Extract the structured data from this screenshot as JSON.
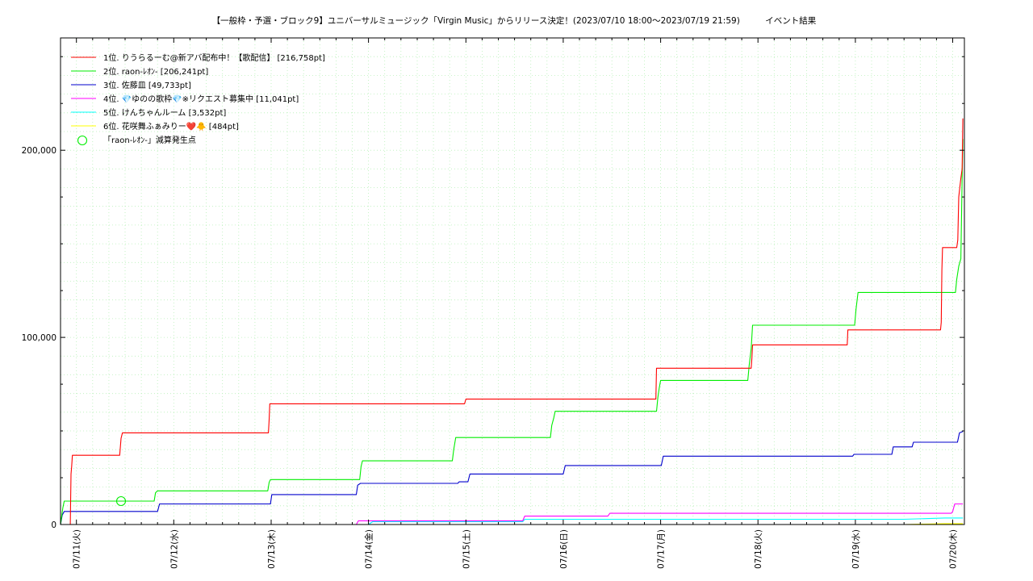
{
  "chart_data": {
    "type": "line",
    "title": "【一般枠・予選・ブロック9】ユニバーサルミュージック「Virgin Music」からリリース決定！(2023/07/10 18:00～2023/07/19 21:59)　　　イベント結果",
    "xlabel": "",
    "ylabel": "",
    "x_ticks": [
      "07/11(火)",
      "07/12(水)",
      "07/13(木)",
      "07/14(金)",
      "07/15(土)",
      "07/16(日)",
      "07/17(月)",
      "07/18(火)",
      "07/19(水)",
      "07/20(木)"
    ],
    "y_ticks": [
      0,
      100000,
      200000
    ],
    "y_tick_labels": [
      "0",
      "100,000",
      "200,000"
    ],
    "xlim": [
      "07/10 20:05",
      "07/20 02:53"
    ],
    "ylim": [
      0,
      260000
    ],
    "grid": true,
    "legend_position": "top-left",
    "series": [
      {
        "name": "1位. りうらるーむ@新アバ配布中！【歌配信】 [216,758pt]",
        "color": "#ff0000",
        "points": [
          [
            "07/10 22:30",
            0
          ],
          [
            "07/10 22:40",
            27000
          ],
          [
            "07/10 22:50",
            31000
          ],
          [
            "07/10 23:00",
            37000
          ],
          [
            "07/11 10:40",
            37000
          ],
          [
            "07/11 11:00",
            46000
          ],
          [
            "07/11 11:20",
            49000
          ],
          [
            "07/12 23:20",
            49000
          ],
          [
            "07/12 23:30",
            56000
          ],
          [
            "07/12 23:40",
            64500
          ],
          [
            "07/14 23:40",
            64500
          ],
          [
            "07/15 00:00",
            67000
          ],
          [
            "07/16 22:50",
            67000
          ],
          [
            "07/16 23:00",
            83500
          ],
          [
            "07/17 22:20",
            83500
          ],
          [
            "07/17 22:30",
            89000
          ],
          [
            "07/17 22:40",
            96000
          ],
          [
            "07/18 22:00",
            96000
          ],
          [
            "07/18 22:10",
            104000
          ],
          [
            "07/19 21:00",
            104000
          ],
          [
            "07/19 21:10",
            108000
          ],
          [
            "07/19 21:20",
            136000
          ],
          [
            "07/19 21:30",
            148000
          ],
          [
            "07/20 01:00",
            148000
          ],
          [
            "07/20 01:15",
            152000
          ],
          [
            "07/20 01:30",
            175000
          ],
          [
            "07/20 02:00",
            185000
          ],
          [
            "07/20 02:20",
            190000
          ],
          [
            "07/20 02:30",
            217000
          ]
        ]
      },
      {
        "name": "2位. raon-ﾚｵﾝ- [206,241pt]",
        "color": "#00ee00",
        "points": [
          [
            "07/10 20:05",
            0
          ],
          [
            "07/10 20:40",
            9000
          ],
          [
            "07/10 21:00",
            12500
          ],
          [
            "07/11 19:10",
            12500
          ],
          [
            "07/11 19:30",
            17000
          ],
          [
            "07/11 20:00",
            18000
          ],
          [
            "07/12 23:10",
            18000
          ],
          [
            "07/12 23:30",
            22500
          ],
          [
            "07/12 23:50",
            24000
          ],
          [
            "07/13 21:50",
            24000
          ],
          [
            "07/13 22:10",
            31000
          ],
          [
            "07/13 22:30",
            34000
          ],
          [
            "07/14 20:40",
            34000
          ],
          [
            "07/14 21:00",
            40000
          ],
          [
            "07/14 21:30",
            46500
          ],
          [
            "07/15 20:50",
            46500
          ],
          [
            "07/15 21:10",
            53000
          ],
          [
            "07/15 21:40",
            57000
          ],
          [
            "07/15 22:00",
            60500
          ],
          [
            "07/16 23:00",
            60500
          ],
          [
            "07/16 23:20",
            68000
          ],
          [
            "07/16 23:40",
            73000
          ],
          [
            "07/17 00:00",
            77000
          ],
          [
            "07/17 21:30",
            77000
          ],
          [
            "07/17 21:50",
            85000
          ],
          [
            "07/17 22:20",
            94000
          ],
          [
            "07/17 22:40",
            106500
          ],
          [
            "07/18 23:50",
            106500
          ],
          [
            "07/19 00:10",
            115000
          ],
          [
            "07/19 00:40",
            124000
          ],
          [
            "07/20 00:40",
            124000
          ],
          [
            "07/20 01:00",
            131000
          ],
          [
            "07/20 01:30",
            138000
          ],
          [
            "07/20 02:00",
            142000
          ],
          [
            "07/20 02:20",
            185000
          ],
          [
            "07/20 02:30",
            206000
          ]
        ]
      },
      {
        "name": "3位. 佐藤皿 [49,733pt]",
        "color": "#0000cc",
        "points": [
          [
            "07/10 20:05",
            0
          ],
          [
            "07/10 20:30",
            5000
          ],
          [
            "07/10 21:00",
            7000
          ],
          [
            "07/11 20:00",
            7000
          ],
          [
            "07/11 20:30",
            11000
          ],
          [
            "07/12 23:50",
            11000
          ],
          [
            "07/13 00:10",
            16000
          ],
          [
            "07/13 21:00",
            16000
          ],
          [
            "07/13 21:20",
            21000
          ],
          [
            "07/13 22:00",
            22000
          ],
          [
            "07/14 22:00",
            22000
          ],
          [
            "07/14 22:20",
            22800
          ],
          [
            "07/15 00:30",
            22800
          ],
          [
            "07/15 01:00",
            27000
          ],
          [
            "07/16 00:00",
            27000
          ],
          [
            "07/16 00:30",
            31500
          ],
          [
            "07/17 00:10",
            31500
          ],
          [
            "07/17 00:40",
            36500
          ],
          [
            "07/18 23:20",
            36500
          ],
          [
            "07/18 23:40",
            37500
          ],
          [
            "07/19 09:00",
            37500
          ],
          [
            "07/19 09:20",
            41500
          ],
          [
            "07/19 14:00",
            41500
          ],
          [
            "07/19 14:20",
            44000
          ],
          [
            "07/20 01:10",
            44000
          ],
          [
            "07/20 01:40",
            49000
          ],
          [
            "07/20 02:30",
            49700
          ]
        ]
      },
      {
        "name": "4位. 💎ゆのの歌枠💎※リクエスト募集中 [11,041pt]",
        "color": "#ff00ff",
        "points": [
          [
            "07/10 20:05",
            0
          ],
          [
            "07/13 21:00",
            0
          ],
          [
            "07/13 21:30",
            2000
          ],
          [
            "07/15 14:00",
            2000
          ],
          [
            "07/15 14:30",
            4500
          ],
          [
            "07/16 11:00",
            4500
          ],
          [
            "07/16 11:30",
            6000
          ],
          [
            "07/19 23:40",
            6000
          ],
          [
            "07/20 00:00",
            7000
          ],
          [
            "07/20 00:30",
            11000
          ],
          [
            "07/20 02:30",
            11000
          ]
        ]
      },
      {
        "name": "5位. けんちゃんルーム [3,532pt]",
        "color": "#00ffff",
        "points": [
          [
            "07/10 20:05",
            0
          ],
          [
            "07/14 00:00",
            0
          ],
          [
            "07/14 01:00",
            1500
          ],
          [
            "07/15 14:00",
            1500
          ],
          [
            "07/15 14:30",
            2800
          ],
          [
            "07/19 12:00",
            2800
          ],
          [
            "07/19 22:00",
            3500
          ],
          [
            "07/20 02:30",
            3500
          ]
        ]
      },
      {
        "name": "6位. 花咲舞ふぁみりー❤️🐥 [484pt]",
        "color": "#ffff00",
        "points": [
          [
            "07/10 20:05",
            0
          ],
          [
            "07/19 12:00",
            0
          ],
          [
            "07/19 22:00",
            484
          ],
          [
            "07/20 02:30",
            484
          ]
        ]
      }
    ],
    "markers": [
      {
        "name": "「raon-ﾚｵﾝ-」減算発生点",
        "color": "#00ee00",
        "x": "07/11 11:00",
        "y": 12500
      }
    ]
  }
}
